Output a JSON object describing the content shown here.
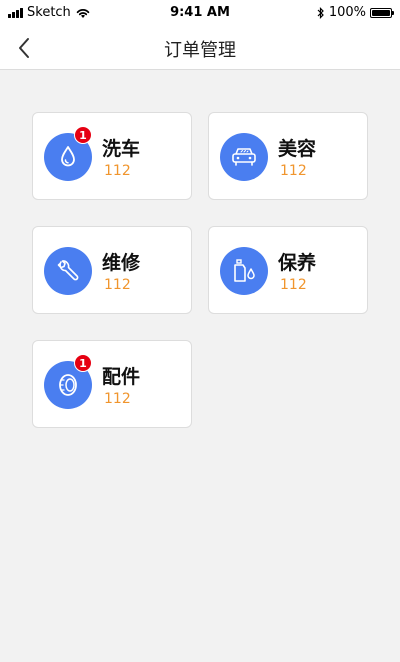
{
  "status_bar": {
    "carrier": "Sketch",
    "time": "9:41 AM",
    "battery": "100%"
  },
  "nav": {
    "title": "订单管理"
  },
  "colors": {
    "accent": "#4a7ef0",
    "badge": "#e60012",
    "count": "#f0952d"
  },
  "cards": [
    {
      "title": "洗车",
      "count": "112",
      "badge": "1",
      "icon": "water-drop-icon"
    },
    {
      "title": "美容",
      "count": "112",
      "icon": "car-icon"
    },
    {
      "title": "维修",
      "count": "112",
      "icon": "wrench-icon"
    },
    {
      "title": "保养",
      "count": "112",
      "icon": "oil-bottle-icon"
    },
    {
      "title": "配件",
      "count": "112",
      "badge": "1",
      "icon": "tire-icon"
    }
  ]
}
